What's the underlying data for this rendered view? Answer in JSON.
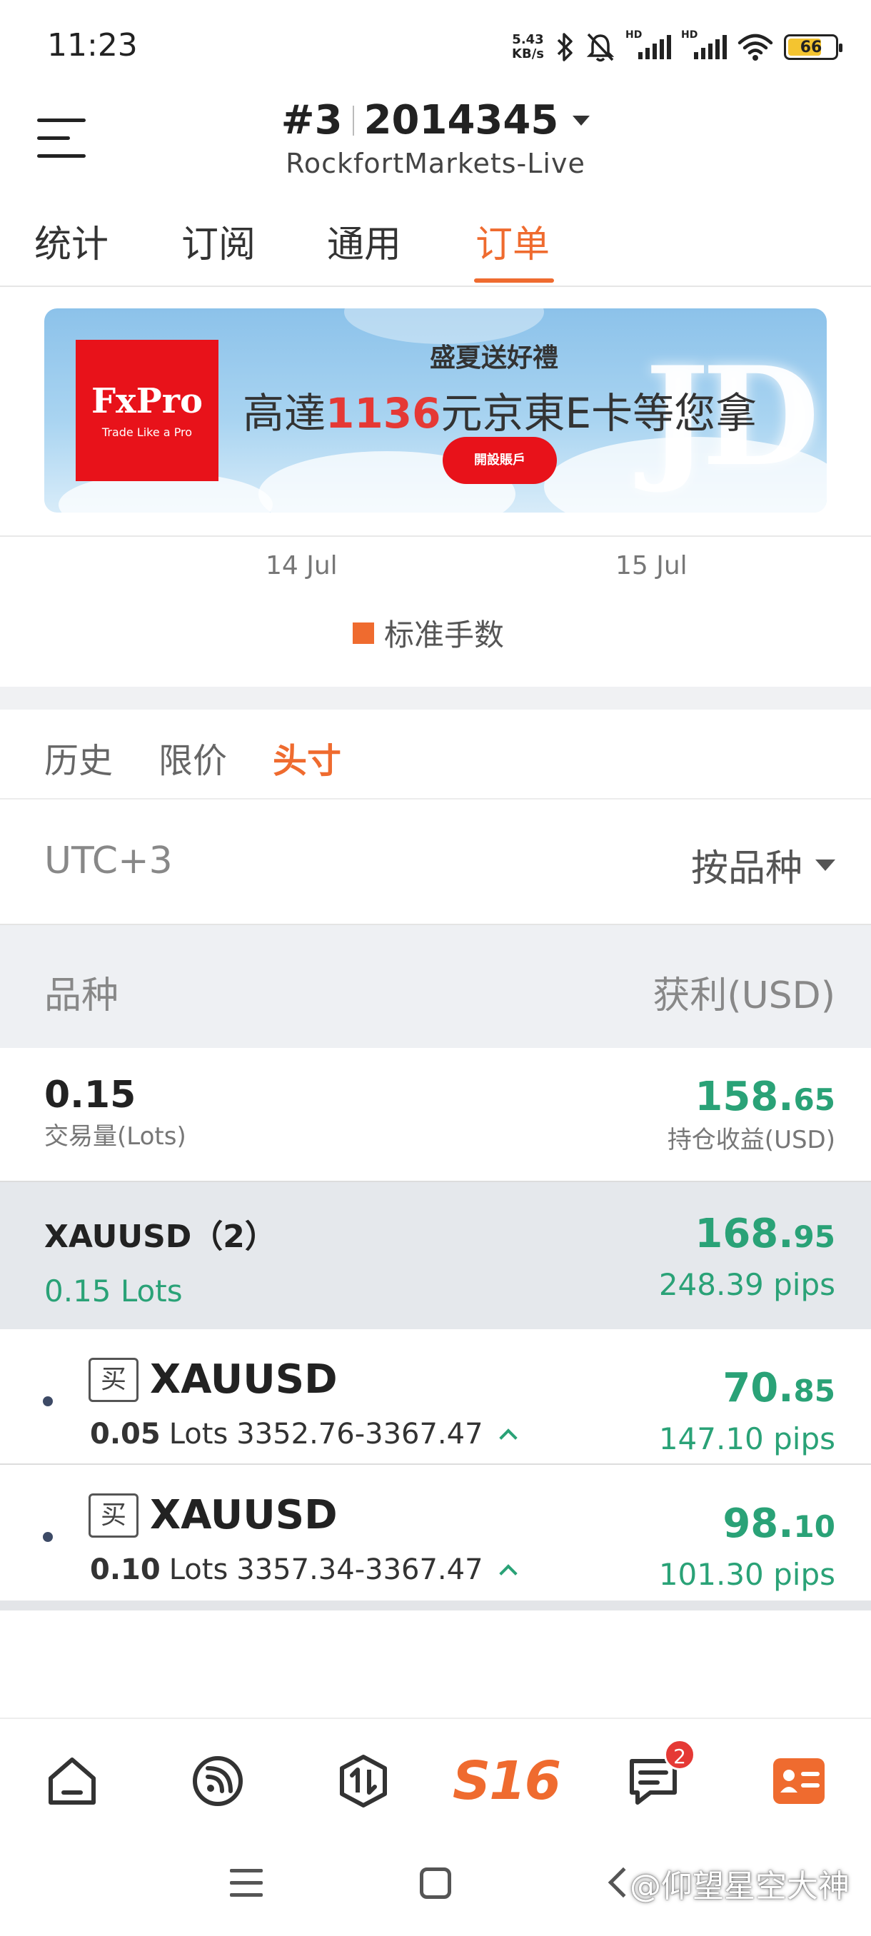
{
  "status_bar": {
    "time": "11:23",
    "net_speed_value": "5.43",
    "net_speed_unit": "KB/s",
    "signal_label": "HD",
    "battery": "66",
    "icons": [
      "bluetooth-icon",
      "mute-bell-icon",
      "signal-icon",
      "signal-icon",
      "wifi-icon",
      "battery-icon"
    ]
  },
  "header": {
    "account_index": "#3",
    "account_number": "2014345",
    "server": "RockfortMarkets-Live"
  },
  "tabs": [
    {
      "label": "统计",
      "active": false
    },
    {
      "label": "订阅",
      "active": false
    },
    {
      "label": "通用",
      "active": false
    },
    {
      "label": "订单",
      "active": true
    }
  ],
  "banner": {
    "logo_brand": "FxPro",
    "logo_tagline": "Trade Like a Pro",
    "title": "盛夏送好禮",
    "main_prefix": "高達",
    "main_highlight": "1136",
    "main_suffix": "元京東E卡等您拿",
    "cta": "開設賬戶",
    "jd_mark": "JD"
  },
  "chart": {
    "date_left": "14 Jul",
    "date_right": "15 Jul",
    "legend": "标准手数",
    "legend_color": "#ef6b2f"
  },
  "subtabs": [
    {
      "label": "历史",
      "active": false
    },
    {
      "label": "限价",
      "active": false
    },
    {
      "label": "头寸",
      "active": true
    }
  ],
  "filter": {
    "timezone": "UTC+3",
    "sort_label": "按品种"
  },
  "table_header": {
    "symbol_col": "品种",
    "profit_col": "获利(USD)"
  },
  "summary": {
    "volume": "0.15",
    "volume_label": "交易量(Lots)",
    "profit_int": "158.",
    "profit_dec": "65",
    "profit_label": "持仓收益(USD)"
  },
  "group": {
    "symbol": "XAUUSD（2）",
    "lots": "0.15 Lots",
    "profit_int": "168.",
    "profit_dec": "95",
    "pips": "248.39 pips"
  },
  "positions": [
    {
      "side": "买",
      "symbol": "XAUUSD",
      "lots": "0.05",
      "lots_unit": "Lots",
      "prices": "3352.76-3367.47",
      "profit_int": "70.",
      "profit_dec": "85",
      "pips": "147.10 pips"
    },
    {
      "side": "买",
      "symbol": "XAUUSD",
      "lots": "0.10",
      "lots_unit": "Lots",
      "prices": "3357.34-3367.47",
      "profit_int": "98.",
      "profit_dec": "10",
      "pips": "101.30 pips"
    }
  ],
  "bottom_nav": {
    "items": [
      "home-icon",
      "feed-icon",
      "trade-icon",
      "s16-logo",
      "messages-icon",
      "profile-card-icon"
    ],
    "s16_label": "S16",
    "message_badge": "2",
    "active_color": "#ef6b2f"
  },
  "watermark": "@仰望星空大神",
  "colors": {
    "accent": "#ef6b2f",
    "profit_green": "#2aa277"
  }
}
